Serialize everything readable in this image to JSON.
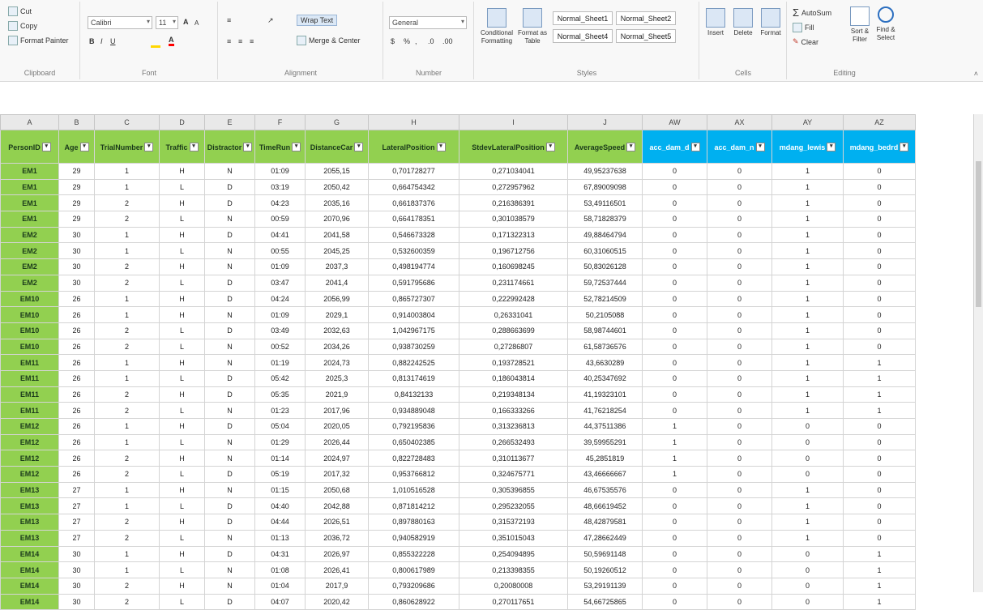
{
  "ribbon": {
    "clipboard": {
      "cut": "Cut",
      "copy": "Copy",
      "format_painter": "Format Painter",
      "label": "Clipboard"
    },
    "font": {
      "name": "Calibri",
      "size": "11",
      "label": "Font"
    },
    "alignment": {
      "wrap_text": "Wrap Text",
      "merge_center": "Merge & Center",
      "label": "Alignment"
    },
    "number": {
      "format": "General",
      "label": "Number"
    },
    "styles": {
      "conditional": "Conditional Formatting",
      "format_table": "Format as Table",
      "cells": [
        "Normal_Sheet1",
        "Normal_Sheet2",
        "Normal_Sheet4",
        "Normal_Sheet5"
      ],
      "label": "Styles"
    },
    "cells": {
      "insert": "Insert",
      "delete": "Delete",
      "format": "Format",
      "label": "Cells"
    },
    "editing": {
      "autosum": "AutoSum",
      "fill": "Fill",
      "clear": "Clear",
      "sort_filter": "Sort & Filter",
      "find_select": "Find & Select",
      "label": "Editing"
    }
  },
  "grid": {
    "column_letters": [
      "A",
      "B",
      "C",
      "D",
      "E",
      "F",
      "G",
      "H",
      "I",
      "J",
      "AW",
      "AX",
      "AY",
      "AZ"
    ],
    "headers": [
      "PersonID",
      "Age",
      "TrialNumber",
      "Traffic",
      "Distractor",
      "TimeRun",
      "DistanceCar",
      "LateralPosition",
      "StdevLateralPosition",
      "AverageSpeed",
      "acc_dam_d",
      "acc_dam_n",
      "mdang_lewis",
      "mdang_bedrd"
    ],
    "rows": [
      [
        "EM1",
        "29",
        "1",
        "H",
        "N",
        "01:09",
        "2055,15",
        "0,701728277",
        "0,271034041",
        "49,95237638",
        "0",
        "0",
        "1",
        "0"
      ],
      [
        "EM1",
        "29",
        "1",
        "L",
        "D",
        "03:19",
        "2050,42",
        "0,664754342",
        "0,272957962",
        "67,89009098",
        "0",
        "0",
        "1",
        "0"
      ],
      [
        "EM1",
        "29",
        "2",
        "H",
        "D",
        "04:23",
        "2035,16",
        "0,661837376",
        "0,216386391",
        "53,49116501",
        "0",
        "0",
        "1",
        "0"
      ],
      [
        "EM1",
        "29",
        "2",
        "L",
        "N",
        "00:59",
        "2070,96",
        "0,664178351",
        "0,301038579",
        "58,71828379",
        "0",
        "0",
        "1",
        "0"
      ],
      [
        "EM2",
        "30",
        "1",
        "H",
        "D",
        "04:41",
        "2041,58",
        "0,546673328",
        "0,171322313",
        "49,88464794",
        "0",
        "0",
        "1",
        "0"
      ],
      [
        "EM2",
        "30",
        "1",
        "L",
        "N",
        "00:55",
        "2045,25",
        "0,532600359",
        "0,196712756",
        "60,31060515",
        "0",
        "0",
        "1",
        "0"
      ],
      [
        "EM2",
        "30",
        "2",
        "H",
        "N",
        "01:09",
        "2037,3",
        "0,498194774",
        "0,160698245",
        "50,83026128",
        "0",
        "0",
        "1",
        "0"
      ],
      [
        "EM2",
        "30",
        "2",
        "L",
        "D",
        "03:47",
        "2041,4",
        "0,591795686",
        "0,231174661",
        "59,72537444",
        "0",
        "0",
        "1",
        "0"
      ],
      [
        "EM10",
        "26",
        "1",
        "H",
        "D",
        "04:24",
        "2056,99",
        "0,865727307",
        "0,222992428",
        "52,78214509",
        "0",
        "0",
        "1",
        "0"
      ],
      [
        "EM10",
        "26",
        "1",
        "H",
        "N",
        "01:09",
        "2029,1",
        "0,914003804",
        "0,26331041",
        "50,2105088",
        "0",
        "0",
        "1",
        "0"
      ],
      [
        "EM10",
        "26",
        "2",
        "L",
        "D",
        "03:49",
        "2032,63",
        "1,042967175",
        "0,288663699",
        "58,98744601",
        "0",
        "0",
        "1",
        "0"
      ],
      [
        "EM10",
        "26",
        "2",
        "L",
        "N",
        "00:52",
        "2034,26",
        "0,938730259",
        "0,27286807",
        "61,58736576",
        "0",
        "0",
        "1",
        "0"
      ],
      [
        "EM11",
        "26",
        "1",
        "H",
        "N",
        "01:19",
        "2024,73",
        "0,882242525",
        "0,193728521",
        "43,6630289",
        "0",
        "0",
        "1",
        "1"
      ],
      [
        "EM11",
        "26",
        "1",
        "L",
        "D",
        "05:42",
        "2025,3",
        "0,813174619",
        "0,186043814",
        "40,25347692",
        "0",
        "0",
        "1",
        "1"
      ],
      [
        "EM11",
        "26",
        "2",
        "H",
        "D",
        "05:35",
        "2021,9",
        "0,84132133",
        "0,219348134",
        "41,19323101",
        "0",
        "0",
        "1",
        "1"
      ],
      [
        "EM11",
        "26",
        "2",
        "L",
        "N",
        "01:23",
        "2017,96",
        "0,934889048",
        "0,166333266",
        "41,76218254",
        "0",
        "0",
        "1",
        "1"
      ],
      [
        "EM12",
        "26",
        "1",
        "H",
        "D",
        "05:04",
        "2020,05",
        "0,792195836",
        "0,313236813",
        "44,37511386",
        "1",
        "0",
        "0",
        "0"
      ],
      [
        "EM12",
        "26",
        "1",
        "L",
        "N",
        "01:29",
        "2026,44",
        "0,650402385",
        "0,266532493",
        "39,59955291",
        "1",
        "0",
        "0",
        "0"
      ],
      [
        "EM12",
        "26",
        "2",
        "H",
        "N",
        "01:14",
        "2024,97",
        "0,822728483",
        "0,310113677",
        "45,2851819",
        "1",
        "0",
        "0",
        "0"
      ],
      [
        "EM12",
        "26",
        "2",
        "L",
        "D",
        "05:19",
        "2017,32",
        "0,953766812",
        "0,324675771",
        "43,46666667",
        "1",
        "0",
        "0",
        "0"
      ],
      [
        "EM13",
        "27",
        "1",
        "H",
        "N",
        "01:15",
        "2050,68",
        "1,010516528",
        "0,305396855",
        "46,67535576",
        "0",
        "0",
        "1",
        "0"
      ],
      [
        "EM13",
        "27",
        "1",
        "L",
        "D",
        "04:40",
        "2042,88",
        "0,871814212",
        "0,295232055",
        "48,66619452",
        "0",
        "0",
        "1",
        "0"
      ],
      [
        "EM13",
        "27",
        "2",
        "H",
        "D",
        "04:44",
        "2026,51",
        "0,897880163",
        "0,315372193",
        "48,42879581",
        "0",
        "0",
        "1",
        "0"
      ],
      [
        "EM13",
        "27",
        "2",
        "L",
        "N",
        "01:13",
        "2036,72",
        "0,940582919",
        "0,351015043",
        "47,28662449",
        "0",
        "0",
        "1",
        "0"
      ],
      [
        "EM14",
        "30",
        "1",
        "H",
        "D",
        "04:31",
        "2026,97",
        "0,855322228",
        "0,254094895",
        "50,59691148",
        "0",
        "0",
        "0",
        "1"
      ],
      [
        "EM14",
        "30",
        "1",
        "L",
        "N",
        "01:08",
        "2026,41",
        "0,800617989",
        "0,213398355",
        "50,19260512",
        "0",
        "0",
        "0",
        "1"
      ],
      [
        "EM14",
        "30",
        "2",
        "H",
        "N",
        "01:04",
        "2017,9",
        "0,793209686",
        "0,20080008",
        "53,29191139",
        "0",
        "0",
        "0",
        "1"
      ],
      [
        "EM14",
        "30",
        "2",
        "L",
        "D",
        "04:07",
        "2020,42",
        "0,860628922",
        "0,270117651",
        "54,66725865",
        "0",
        "0",
        "0",
        "1"
      ]
    ]
  }
}
